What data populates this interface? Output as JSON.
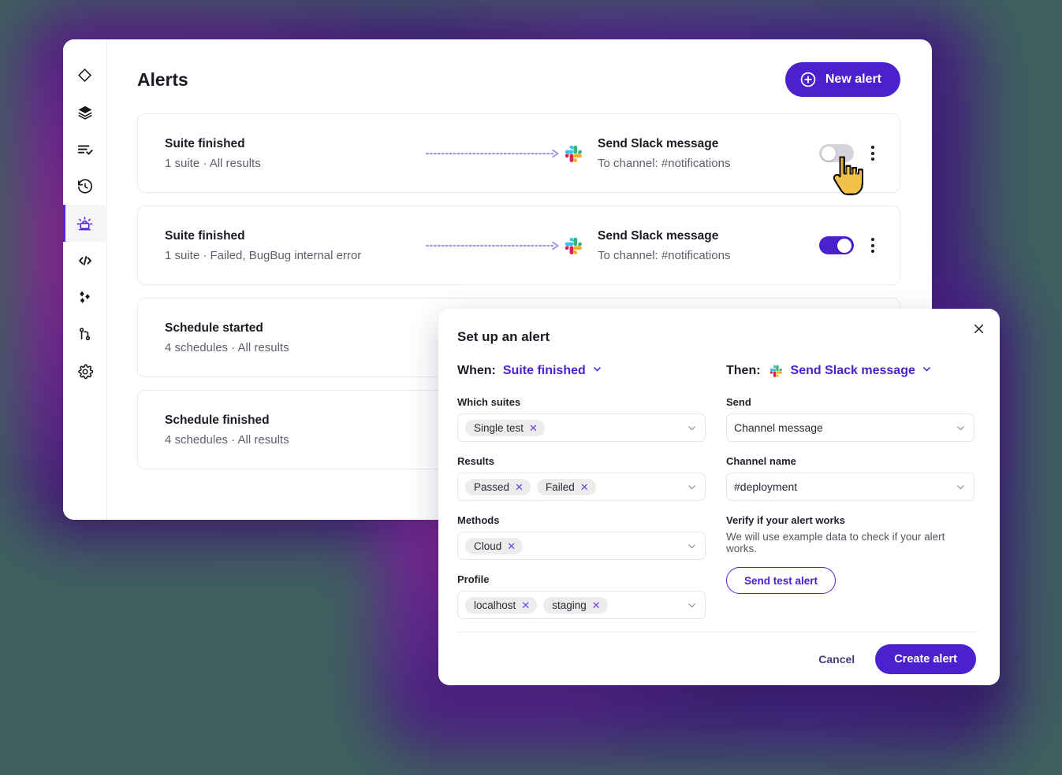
{
  "app": {
    "page_title": "Alerts",
    "new_alert_button": "New alert"
  },
  "sidebar": {
    "items": [
      {
        "icon": "diamond-icon",
        "name": "sidebar-item-overview",
        "active": false
      },
      {
        "icon": "layers-icon",
        "name": "sidebar-item-suites",
        "active": false
      },
      {
        "icon": "list-check-icon",
        "name": "sidebar-item-tests",
        "active": false
      },
      {
        "icon": "history-icon",
        "name": "sidebar-item-history",
        "active": false
      },
      {
        "icon": "alert-siren-icon",
        "name": "sidebar-item-alerts",
        "active": true
      },
      {
        "icon": "code-icon",
        "name": "sidebar-item-code",
        "active": false
      },
      {
        "icon": "sparkle-icon",
        "name": "sidebar-item-integrations",
        "active": false
      },
      {
        "icon": "git-branch-icon",
        "name": "sidebar-item-branches",
        "active": false
      },
      {
        "icon": "gear-icon",
        "name": "sidebar-item-settings",
        "active": false
      }
    ]
  },
  "alerts": [
    {
      "trigger_title": "Suite finished",
      "trigger_subtitle": "1 suite · All results",
      "action_title": "Send Slack message",
      "action_subtitle": "To channel: #notifications",
      "action_icon": "slack-icon",
      "enabled": false
    },
    {
      "trigger_title": "Suite finished",
      "trigger_subtitle": "1 suite · Failed, BugBug internal error",
      "action_title": "Send Slack message",
      "action_subtitle": "To channel: #notifications",
      "action_icon": "slack-icon",
      "enabled": true
    },
    {
      "trigger_title": "Schedule started",
      "trigger_subtitle": "4 schedules · All results",
      "action_title": "",
      "action_subtitle": "",
      "action_icon": "",
      "enabled": false
    },
    {
      "trigger_title": "Schedule finished",
      "trigger_subtitle": "4 schedules · All results",
      "action_title": "",
      "action_subtitle": "",
      "action_icon": "",
      "enabled": false
    }
  ],
  "modal": {
    "title": "Set up an alert",
    "close_icon": "close-icon",
    "when_label": "When:",
    "when_value": "Suite finished",
    "then_label": "Then:",
    "then_value": "Send Slack message",
    "then_icon": "slack-icon",
    "left_fields": [
      {
        "label": "Which suites",
        "name": "which-suites-select",
        "chips": [
          "Single test"
        ]
      },
      {
        "label": "Results",
        "name": "results-select",
        "chips": [
          "Passed",
          "Failed"
        ]
      },
      {
        "label": "Methods",
        "name": "methods-select",
        "chips": [
          "Cloud"
        ]
      },
      {
        "label": "Profile",
        "name": "profile-select",
        "chips": [
          "localhost",
          "staging"
        ]
      }
    ],
    "right_fields": [
      {
        "label": "Send",
        "name": "send-select",
        "value": "Channel message"
      },
      {
        "label": "Channel name",
        "name": "channel-name-select",
        "value": "#deployment"
      }
    ],
    "verify": {
      "title": "Verify if your alert works",
      "description": "We will use example data to check if your alert works.",
      "button": "Send test alert"
    },
    "cancel_button": "Cancel",
    "create_button": "Create alert"
  },
  "colors": {
    "accent": "#4b20cf",
    "accent_light": "#5b21d6",
    "toggle_off": "#d4d4dc",
    "connector": "#a79ae0",
    "glow_purple": "#6a2391",
    "glow_magenta": "#8e2a8e",
    "chip_bg": "#ececed"
  },
  "cursor": {
    "name": "hand-pointer-cursor"
  }
}
